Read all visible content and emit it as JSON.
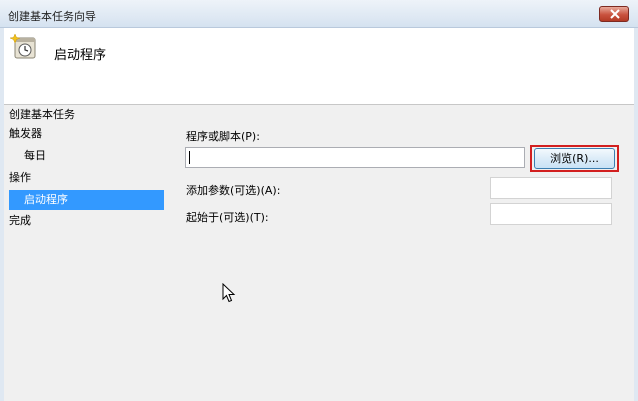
{
  "window": {
    "title": "创建基本任务向导"
  },
  "header": {
    "title": "启动程序",
    "icon": "scheduled-task-icon"
  },
  "sidebar": {
    "heading": "创建基本任务",
    "items": [
      {
        "label": "触发器",
        "selected": false
      },
      {
        "label": "每日",
        "selected": false
      },
      {
        "label": "操作",
        "selected": false
      },
      {
        "label": "启动程序",
        "selected": true
      },
      {
        "label": "完成",
        "selected": false
      }
    ]
  },
  "form": {
    "program_label": "程序或脚本(P):",
    "program_value": "",
    "browse_label": "浏览(R)...",
    "args_label": "添加参数(可选)(A):",
    "args_value": "",
    "startin_label": "起始于(可选)(T):",
    "startin_value": ""
  },
  "colors": {
    "selection": "#3399ff",
    "highlight_outline": "#d21f1f"
  }
}
